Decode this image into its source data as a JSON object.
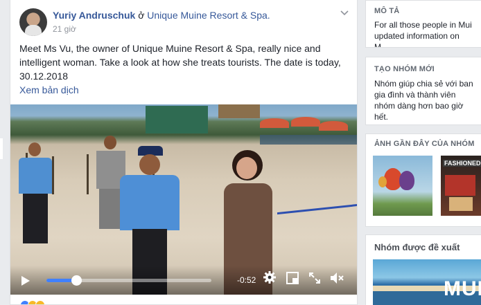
{
  "post": {
    "author": "Yuriy Andruschuk",
    "at": "ở",
    "group": "Unique Muine Resort & Spa.",
    "time": "21 giờ",
    "text": "Meet Ms Vu, the owner of Unique Muine Resort & Spa, really nice and intelligent woman. Take a look at how she treats tourists. The date is today, 30.12.2018",
    "translate": "Xem bản dịch",
    "menu_icon": "chevron-down-icon"
  },
  "video": {
    "remaining": "-0:52",
    "progress_fraction": 0.18,
    "icons": [
      "play-icon",
      "settings-icon",
      "pip-icon",
      "fullscreen-icon",
      "volume-icon"
    ]
  },
  "sidebar": {
    "description": {
      "heading": "MÔ TẢ",
      "text": "For all those people in Mui updated information on M..."
    },
    "create_group": {
      "heading": "TẠO NHÓM MỚI",
      "text": "Nhóm giúp chia sẻ với ban gia đình và thành viên nhóm dàng hơn bao giờ hết."
    },
    "recent_photos": {
      "heading": "ẢNH GẦN ĐÂY CỦA NHÓM",
      "photo2_caption": "FASHIONED"
    },
    "suggested": {
      "heading": "Nhóm được đề xuất",
      "image_text": "MUI"
    }
  },
  "colors": {
    "link": "#365899",
    "progress": "#4080ff",
    "background": "#e9ebee"
  }
}
